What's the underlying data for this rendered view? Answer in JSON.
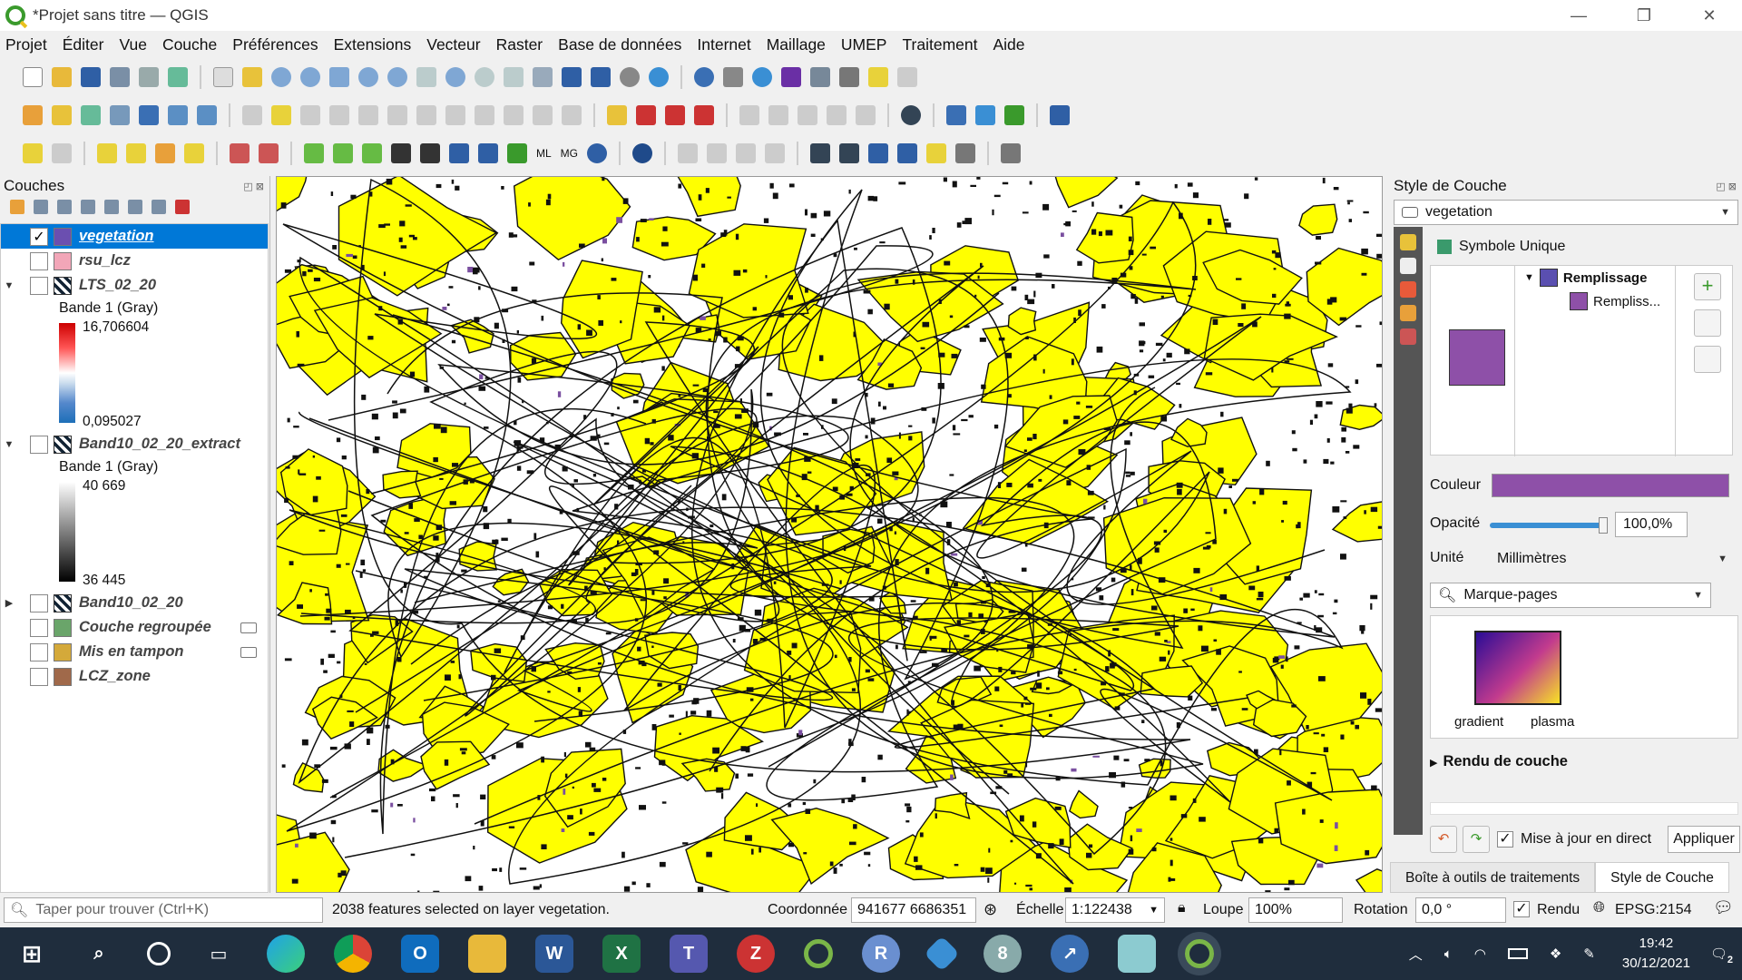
{
  "window": {
    "title": "*Projet sans titre — QGIS",
    "controls": [
      "—",
      "❐",
      "✕"
    ]
  },
  "menu": [
    "Projet",
    "Éditer",
    "Vue",
    "Couche",
    "Préférences",
    "Extensions",
    "Vecteur",
    "Raster",
    "Base de données",
    "Internet",
    "Maillage",
    "UMEP",
    "Traitement",
    "Aide"
  ],
  "layers_panel": {
    "title": "Couches",
    "layers": [
      {
        "name": "vegetation",
        "checked": "✓",
        "selected": true,
        "swatch": "#6b4fb0"
      },
      {
        "name": "rsu_lcz",
        "checked": "",
        "swatch": "#f2a6b8"
      },
      {
        "name": "LTS_02_20",
        "checked": "",
        "raster": true,
        "expanded": true,
        "legend": {
          "band": "Bande 1 (Gray)",
          "max": "16,706604",
          "min": "0,095027"
        }
      },
      {
        "name": "Band10_02_20_extract",
        "checked": "",
        "raster": true,
        "expanded": true,
        "legend": {
          "band": "Bande 1 (Gray)",
          "max": "40 669",
          "min": "36 445"
        }
      },
      {
        "name": "Band10_02_20",
        "checked": "",
        "raster": true,
        "collapsed": true
      },
      {
        "name": "Couche regroupée",
        "checked": "",
        "swatch": "#6aa56a"
      },
      {
        "name": "Mis en tampon",
        "checked": "",
        "swatch": "#d4a93a"
      },
      {
        "name": "LCZ_zone",
        "checked": "",
        "swatch": "#a0694a"
      }
    ]
  },
  "style_panel": {
    "title": "Style de Couche",
    "layer_combo": "vegetation",
    "renderer": "Symbole Unique",
    "symbol_tree": {
      "root": "Remplissage",
      "child": "Rempliss..."
    },
    "symbol_color": "#8e50a8",
    "couleur_label": "Couleur",
    "opacite_label": "Opacité",
    "opacite_value": "100,0%",
    "opacity_fraction": 1.0,
    "unite_label": "Unité",
    "unite_value": "Millimètres",
    "search_placeholder": "Marque-pages",
    "gradient_labels": [
      "gradient",
      "plasma"
    ],
    "rendu_label": "Rendu de couche",
    "live_update": "Mise à jour en direct",
    "apply": "Appliquer",
    "tabs": [
      "Boîte à outils de traitements",
      "Style de Couche"
    ]
  },
  "statusbar": {
    "search_placeholder": "Taper pour trouver (Ctrl+K)",
    "message": "2038 features selected on layer vegetation.",
    "coord_label": "Coordonnée",
    "coord_value": "941677 6686351",
    "scale_label": "Échelle",
    "scale_value": "1:122438",
    "loupe_label": "Loupe",
    "loupe_value": "100%",
    "rotation_label": "Rotation",
    "rotation_value": "0,0 °",
    "rendu_label": "Rendu",
    "crs": "EPSG:2154"
  },
  "taskbar": {
    "time": "19:42",
    "date": "30/12/2021",
    "notifications": "2"
  },
  "colors": {
    "map_fill": "#ffff00",
    "selection": "#0078d7",
    "accent": "#8e50a8"
  }
}
